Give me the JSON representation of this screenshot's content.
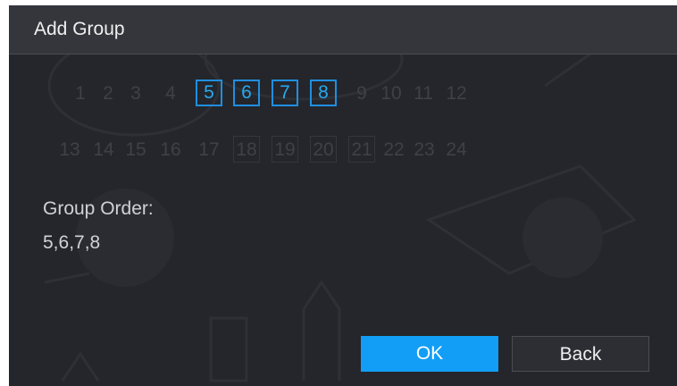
{
  "dialog": {
    "title": "Add Group",
    "channels": [
      {
        "label": "1",
        "selected": false
      },
      {
        "label": "2",
        "selected": false
      },
      {
        "label": "3",
        "selected": false
      },
      {
        "label": "4",
        "selected": false
      },
      {
        "label": "5",
        "selected": true
      },
      {
        "label": "6",
        "selected": true
      },
      {
        "label": "7",
        "selected": true
      },
      {
        "label": "8",
        "selected": true
      },
      {
        "label": "9",
        "selected": false
      },
      {
        "label": "10",
        "selected": false
      },
      {
        "label": "11",
        "selected": false
      },
      {
        "label": "12",
        "selected": false
      },
      {
        "label": "13",
        "selected": false
      },
      {
        "label": "14",
        "selected": false
      },
      {
        "label": "15",
        "selected": false
      },
      {
        "label": "16",
        "selected": false
      },
      {
        "label": "17",
        "selected": false
      },
      {
        "label": "18",
        "selected": false
      },
      {
        "label": "19",
        "selected": false
      },
      {
        "label": "20",
        "selected": false
      },
      {
        "label": "21",
        "selected": false
      },
      {
        "label": "22",
        "selected": false
      },
      {
        "label": "23",
        "selected": false
      },
      {
        "label": "24",
        "selected": false
      }
    ],
    "group_order_label": "Group Order:",
    "group_order_value": "5,6,7,8",
    "ok_label": "OK",
    "back_label": "Back"
  },
  "colors": {
    "selected_accent": "#1f8fe0",
    "ok_button": "#129ef6",
    "dialog_background": "#24262b"
  }
}
